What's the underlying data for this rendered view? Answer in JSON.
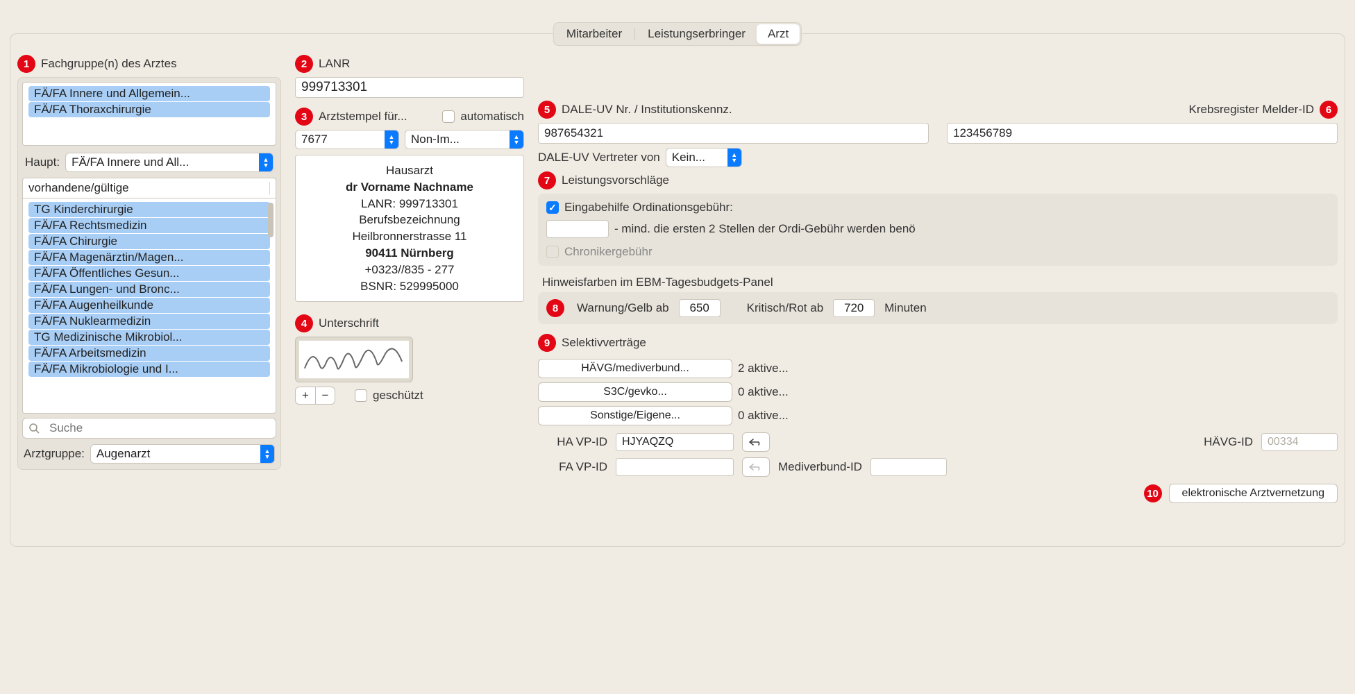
{
  "tabs": {
    "t1": "Mitarbeiter",
    "t2": "Leistungserbringer",
    "t3": "Arzt"
  },
  "badges": {
    "b1": "1",
    "b2": "2",
    "b3": "3",
    "b4": "4",
    "b5": "5",
    "b6": "6",
    "b7": "7",
    "b8": "8",
    "b9": "9",
    "b10": "10"
  },
  "col1": {
    "title": "Fachgruppe(n) des Arztes",
    "selected_groups": [
      "FÄ/FA Innere und Allgemein...",
      "FÄ/FA Thoraxchirurgie"
    ],
    "haupt_label": "Haupt:",
    "haupt_value": "FÄ/FA Innere und All...",
    "filter_value": "vorhandene/gültige",
    "all_groups": [
      "TG Kinderchirurgie",
      "FÄ/FA Rechtsmedizin",
      "FÄ/FA Chirurgie",
      "FÄ/FA Magenärztin/Magen...",
      "FÄ/FA Öffentliches Gesun...",
      "FÄ/FA Lungen- und Bronc...",
      "FÄ/FA Augenheilkunde",
      "FÄ/FA Nuklearmedizin",
      "TG Medizinische Mikrobiol...",
      "FÄ/FA Arbeitsmedizin",
      "FÄ/FA Mikrobiologie und I..."
    ],
    "search_placeholder": "Suche",
    "arztgruppe_label": "Arztgruppe:",
    "arztgruppe_value": "Augenarzt"
  },
  "col2": {
    "lanr_label": "LANR",
    "lanr_value": "999713301",
    "stempel_label": "Arztstempel für...",
    "auto_label": "automatisch",
    "sel_bsnr": "7677",
    "sel_font": "Non-Im...",
    "stamp": {
      "l1": "Hausarzt",
      "l2": "dr Vorname Nachname",
      "l3": "LANR: 999713301",
      "l4": "Berufsbezeichnung",
      "l5": "Heilbronnerstrasse 11",
      "l6": "90411 Nürnberg",
      "l7": "+0323//835 - 277",
      "l8": "BSNR: 529995000"
    },
    "sig_label": "Unterschrift",
    "protected_label": "geschützt"
  },
  "col3": {
    "dale_label": "DALE-UV Nr. / Institutionskennz.",
    "dale_value": "987654321",
    "krebs_label": "Krebsregister Melder-ID",
    "krebs_value": "123456789",
    "dale_vertr_label": "DALE-UV Vertreter von",
    "dale_vertr_value": "Kein...",
    "leistung_label": "Leistungsvorschläge",
    "ordi_label": "Eingabehilfe Ordinationsgebühr:",
    "ordi_note": "- mind. die ersten 2 Stellen der Ordi-Gebühr werden benö",
    "chronik_label": "Chronikergebühr",
    "hinweis_label": "Hinweisfarben im EBM-Tagesbudgets-Panel",
    "warn_label": "Warnung/Gelb ab",
    "warn_value": "650",
    "krit_label": "Kritisch/Rot ab",
    "krit_value": "720",
    "min_label": "Minuten",
    "selektiv_label": "Selektivverträge",
    "sv_rows": [
      {
        "btn": "HÄVG/mediverbund...",
        "txt": "2 aktive..."
      },
      {
        "btn": "S3C/gevko...",
        "txt": "0 aktive..."
      },
      {
        "btn": "Sonstige/Eigene...",
        "txt": "0 aktive..."
      }
    ],
    "ha_vpid_label": "HA VP-ID",
    "ha_vpid_value": "HJYAQZQ",
    "haevg_label": "HÄVG-ID",
    "haevg_value": "00334",
    "fa_vpid_label": "FA VP-ID",
    "fa_vpid_value": "",
    "medi_label": "Mediverbund-ID",
    "medi_value": "",
    "evernetz_label": "elektronische Arztvernetzung"
  }
}
